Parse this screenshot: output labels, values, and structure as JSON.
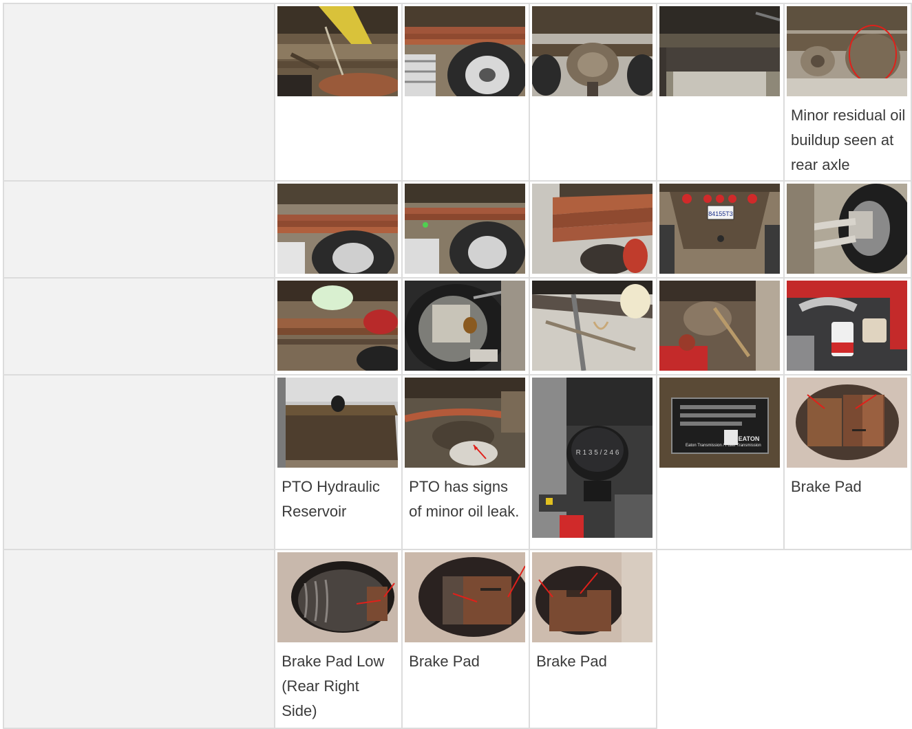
{
  "rows": [
    {
      "photos": [
        {
          "icon": "undercarriage-frame-photo",
          "caption": ""
        },
        {
          "icon": "leaf-spring-tire-photo",
          "caption": ""
        },
        {
          "icon": "rear-differential-photo",
          "caption": ""
        },
        {
          "icon": "chassis-crossmember-photo",
          "caption": ""
        },
        {
          "icon": "rear-axle-oil-photo",
          "caption": "Minor residual oil buildup seen at rear axle"
        }
      ]
    },
    {
      "photos": [
        {
          "icon": "leaf-spring-wheel-photo",
          "caption": ""
        },
        {
          "icon": "leaf-spring-dual-tire-photo",
          "caption": ""
        },
        {
          "icon": "leaf-spring-closeup-photo",
          "caption": ""
        },
        {
          "icon": "rear-plate-lights-photo",
          "caption": ""
        },
        {
          "icon": "brake-caliper-photo",
          "caption": ""
        }
      ]
    },
    {
      "photos": [
        {
          "icon": "front-axle-photo",
          "caption": ""
        },
        {
          "icon": "front-brake-caliper-photo",
          "caption": ""
        },
        {
          "icon": "steering-linkage-photo",
          "caption": ""
        },
        {
          "icon": "engine-bay-red-photo",
          "caption": ""
        },
        {
          "icon": "engine-reservoir-photo",
          "caption": ""
        }
      ]
    },
    {
      "photos": [
        {
          "icon": "pto-reservoir-photo",
          "caption": "PTO Hydraulic Reservoir"
        },
        {
          "icon": "pto-leak-photo",
          "caption": "PTO has signs of minor oil leak."
        },
        {
          "icon": "gear-shifter-photo",
          "caption": ""
        },
        {
          "icon": "transmission-plate-photo",
          "caption": ""
        },
        {
          "icon": "brake-pad-photo",
          "caption": "Brake Pad"
        }
      ]
    },
    {
      "photos": [
        {
          "icon": "brake-pad-low-photo",
          "caption": "Brake Pad Low (Rear Right Side)"
        },
        {
          "icon": "brake-pad-photo",
          "caption": "Brake Pad"
        },
        {
          "icon": "brake-pad-photo",
          "caption": "Brake Pad"
        }
      ]
    }
  ],
  "plate_text": "84155T3",
  "shifter_gears": "R 1 3 5 / 2 4 6",
  "transmission_brand": "EATON",
  "transmission_text": "Eaton Transmission / Fuller Transmission",
  "colors": {
    "label_bg": "#f2f2f2",
    "grid_line": "#dcdcdc",
    "caption_text": "#3a3a3a",
    "rust": "#8a5a3a",
    "brake_red": "#e0201a"
  }
}
